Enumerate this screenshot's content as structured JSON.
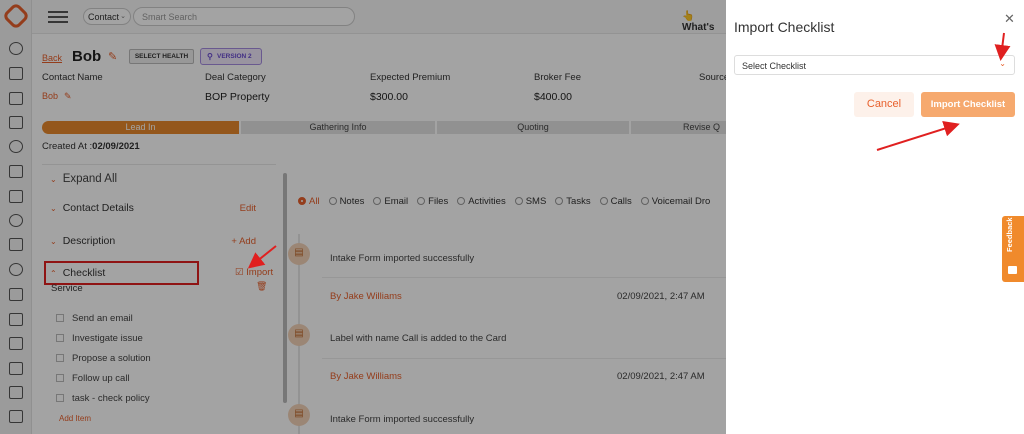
{
  "topbar": {
    "contact_select": "Contact",
    "search_placeholder": "Smart Search",
    "whats_new": "What's"
  },
  "header": {
    "back": "Back",
    "name": "Bob",
    "health_button": "SELECT HEALTH",
    "version_button": "VERSION 2"
  },
  "fields": [
    {
      "label": "Contact Name",
      "value": "Bob"
    },
    {
      "label": "Deal Category",
      "value": "BOP Property"
    },
    {
      "label": "Expected Premium",
      "value": "$300.00"
    },
    {
      "label": "Broker Fee",
      "value": "$400.00"
    },
    {
      "label": "Source",
      "value": ""
    }
  ],
  "pipeline": [
    "Lead In",
    "Gathering Info",
    "Quoting",
    "Revise Q"
  ],
  "created_label": "Created At :",
  "created_value": "02/09/2021",
  "left_panel": {
    "expand_all": "Expand All",
    "contact_details": "Contact Details",
    "contact_details_action": "Edit",
    "description": "Description",
    "description_action": "+ Add",
    "checklist": "Checklist",
    "checklist_action": "Import",
    "service": "Service",
    "items": [
      "Send an email",
      "Investigate issue",
      "Propose a solution",
      "Follow up call",
      "task - check policy"
    ],
    "add_item": "Add Item"
  },
  "filters": [
    "All",
    "Notes",
    "Email",
    "Files",
    "Activities",
    "SMS",
    "Tasks",
    "Calls",
    "Voicemail Dro"
  ],
  "feed": [
    {
      "text": "Intake Form imported successfully",
      "author": "By Jake Williams",
      "time": "02/09/2021, 2:47 AM"
    },
    {
      "text": "Label with name Call is added to the Card",
      "author": "By Jake Williams",
      "time": "02/09/2021, 2:47 AM"
    },
    {
      "text": "Intake Form imported successfully",
      "author": "",
      "time": ""
    }
  ],
  "modal": {
    "title": "Import Checklist",
    "select_placeholder": "Select Checklist",
    "cancel": "Cancel",
    "import": "Import Checklist"
  },
  "feedback": "Feedback",
  "colors": {
    "accent": "#e8602c",
    "annotation": "#e02020"
  }
}
